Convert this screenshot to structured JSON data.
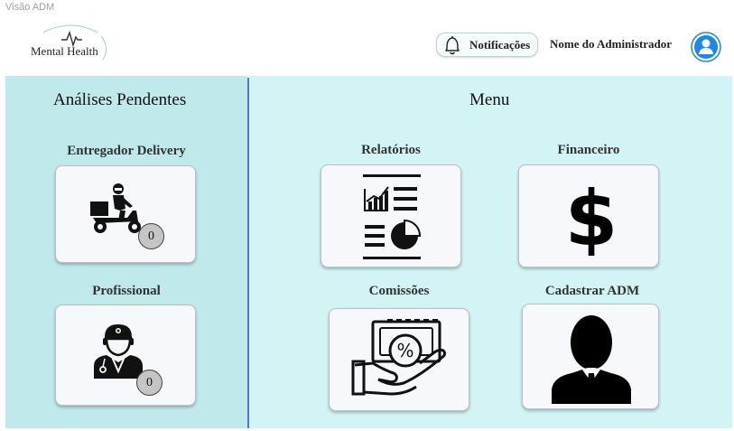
{
  "frame_label": "Visão ADM",
  "header": {
    "logo_text": "Mental Health",
    "notifications_label": "Notificações",
    "admin_name": "Nome do Administrador"
  },
  "pending": {
    "title": "Análises Pendentes",
    "items": [
      {
        "label": "Entregador Delivery",
        "count": "0",
        "icon": "delivery-rider-icon"
      },
      {
        "label": "Profissional",
        "count": "0",
        "icon": "doctor-icon"
      }
    ]
  },
  "menu": {
    "title": "Menu",
    "items": [
      {
        "label": "Relatórios",
        "icon": "report-chart-icon"
      },
      {
        "label": "Financeiro",
        "icon": "dollar-icon"
      },
      {
        "label": "Comissões",
        "icon": "commission-hand-icon"
      },
      {
        "label": "Cadastrar ADM",
        "icon": "admin-person-icon"
      }
    ]
  },
  "colors": {
    "left_panel": "#bfe9ea",
    "right_panel": "#d3f4f5",
    "divider": "#4b7bd1",
    "avatar": "#1e88e5"
  }
}
